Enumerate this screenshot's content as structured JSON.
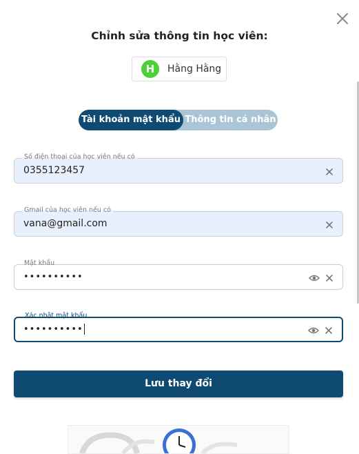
{
  "modal": {
    "title": "Chỉnh sửa thông tin học viên:"
  },
  "user": {
    "initial": "H",
    "name": "Hằng Hằng",
    "avatar_color": "#4cd137"
  },
  "tabs": [
    {
      "label": "Tài khoản mật khẩu",
      "active": true
    },
    {
      "label": "Thông tin cá nhân",
      "active": false
    }
  ],
  "fields": {
    "phone": {
      "label": "Số điện thoại của học viên nếu có",
      "value": "0355123457"
    },
    "gmail": {
      "label": "Gmail của học viên nếu có",
      "value": "vana@gmail.com"
    },
    "password": {
      "label": "Mật khẩu",
      "value": "••••••••••"
    },
    "confirm_password": {
      "label": "Xác nhật mật khẩu",
      "value": "••••••••••"
    }
  },
  "actions": {
    "save_label": "Lưu thay đổi"
  },
  "colors": {
    "primary": "#0e4a72",
    "tab_inactive_bg": "#a9c5d6",
    "filled_field_bg": "#e9f0fd"
  },
  "icons": {
    "close": "close-icon",
    "clear": "clear-icon",
    "eye": "eye-icon",
    "clock": "clock-icon"
  }
}
